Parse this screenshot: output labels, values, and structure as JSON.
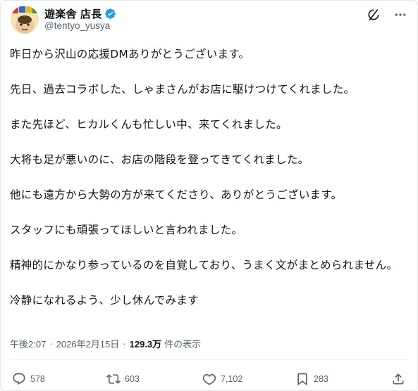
{
  "user": {
    "display_name": "遊楽舎 店長",
    "handle": "@tentyo_yusya"
  },
  "icons": {
    "verified": "verified-badge-icon",
    "grok": "grok-icon",
    "more": "more-icon",
    "reply": "reply-icon",
    "retweet": "retweet-icon",
    "like": "heart-icon",
    "bookmark": "bookmark-icon",
    "share": "share-icon"
  },
  "colors": {
    "verified": "#1d9bf0",
    "text": "#0f1419",
    "muted": "#536471"
  },
  "tweet": {
    "paragraphs": [
      "昨日から沢山の応援DMありがとうございます。",
      "先日、過去コラボした、しゃまさんがお店に駆けつけてくれました。",
      "また先ほど、ヒカルくんも忙しい中、来てくれました。",
      "大将も足が悪いのに、お店の階段を登ってきてくれました。",
      "他にも遠方から大勢の方が来てくださり、ありがとうございます。",
      "スタッフにも頑張ってほしいと言われました。",
      "精神的にかなり参っているのを自覚しており、うまく文がまとめられません。",
      "冷静になれるよう、少し休んでみます"
    ]
  },
  "meta": {
    "time": "午後2:07",
    "date": "2026年2月15日",
    "separator": "·",
    "views": "129.3万",
    "views_label": "件の表示"
  },
  "actions": {
    "replies": "578",
    "retweets": "603",
    "likes": "7,102",
    "bookmarks": "283"
  }
}
